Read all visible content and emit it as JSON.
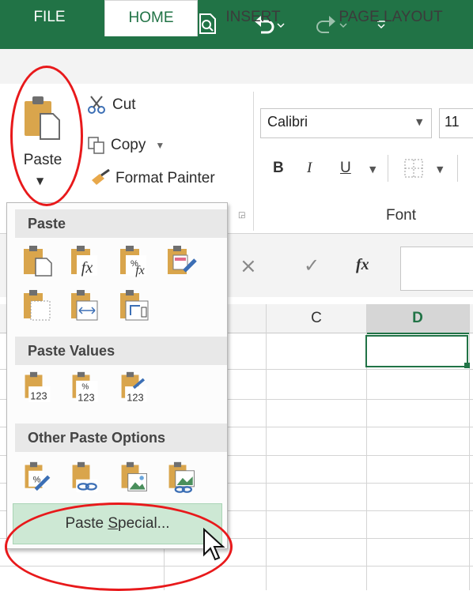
{
  "qat": {
    "icons": [
      "excel-logo-icon",
      "new-icon",
      "save-icon",
      "save-as-icon",
      "print-preview-icon",
      "undo-icon",
      "redo-icon",
      "customize-icon"
    ]
  },
  "tabs": [
    {
      "label": "FILE"
    },
    {
      "label": "HOME"
    },
    {
      "label": "INSERT"
    },
    {
      "label": "PAGE LAYOUT"
    }
  ],
  "clipboard": {
    "paste_label": "Paste",
    "cut_label": "Cut",
    "copy_label": "Copy",
    "format_painter_label": "Format Painter"
  },
  "font": {
    "family": "Calibri",
    "size": "11",
    "bold": "B",
    "italic": "I",
    "underline": "U",
    "group_label": "Font"
  },
  "formula_bar": {
    "cancel": "×",
    "enter": "✓",
    "fx": "fx"
  },
  "grid": {
    "columns": [
      "C",
      "D"
    ]
  },
  "paste_menu": {
    "sections": [
      {
        "title": "Paste"
      },
      {
        "title": "Paste Values"
      },
      {
        "title": "Other Paste Options"
      }
    ],
    "paste_special_prefix": "Paste ",
    "paste_special_underlined": "S",
    "paste_special_suffix": "pecial..."
  },
  "colors": {
    "excel_green": "#217346",
    "annotation_red": "#e8191b",
    "selection_green": "#217346"
  }
}
